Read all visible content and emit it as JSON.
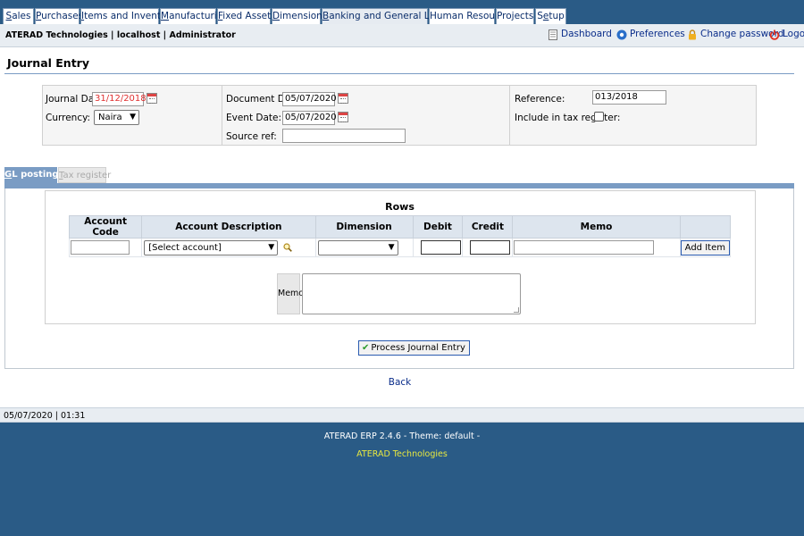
{
  "top_menu": [
    {
      "text": "Sales",
      "u": "S",
      "rest": "ales"
    },
    {
      "text": "Purchases",
      "u": "P",
      "rest": "urchases"
    },
    {
      "text": "Items and Inventory",
      "u": "I",
      "rest": "tems and Inventory"
    },
    {
      "text": "Manufacturing",
      "u": "M",
      "rest": "anufacturing"
    },
    {
      "text": "Fixed Assets",
      "u": "F",
      "rest": "ixed Assets"
    },
    {
      "text": "Dimensions",
      "u": "D",
      "rest": "imensions"
    },
    {
      "text": "Banking and General Ledger",
      "u": "B",
      "rest": "anking and General Ledger"
    },
    {
      "text": "Human Resource",
      "u": "",
      "rest": "Human Resource"
    },
    {
      "text": "Projects",
      "u": "",
      "rest": "Projects"
    },
    {
      "text": "Setup",
      "pre": "S",
      "u": "e",
      "rest": "tup"
    }
  ],
  "header": {
    "company": "ATERAD Technologies | localhost | Administrator",
    "dashboard": "Dashboard",
    "preferences": "Preferences",
    "change_password": "Change password",
    "logout": "Logout"
  },
  "page_title": "Journal Entry",
  "form": {
    "journal_date_label": "Journal Date:",
    "journal_date_value": "31/12/2018",
    "currency_label": "Currency:",
    "currency_value": "Naira",
    "document_date_label": "Document Date:",
    "document_date_value": "05/07/2020",
    "event_date_label": "Event Date:",
    "event_date_value": "05/07/2020",
    "source_ref_label": "Source ref:",
    "source_ref_value": "",
    "reference_label": "Reference:",
    "reference_value": "013/2018",
    "tax_register_label": "Include in tax register:"
  },
  "tabs": {
    "gl_postings": {
      "u": "G",
      "rest": "L postings"
    },
    "tax_register": {
      "u": "T",
      "rest": "ax register"
    }
  },
  "rows": {
    "title": "Rows",
    "columns": [
      "Account Code",
      "Account Description",
      "Dimension",
      "Debit",
      "Credit",
      "Memo"
    ],
    "account_select": "[Select account]",
    "add_item": "Add Item"
  },
  "memo_label": "Memo",
  "process_button": "Process Journal Entry",
  "back": "Back",
  "status": "05/07/2020 | 01:31",
  "footer": {
    "version": "ATERAD ERP 2.4.6 - Theme: default -",
    "company": "ATERAD Technologies"
  },
  "colors": {
    "background": "#2a5b86",
    "accent": "#7a9cc4",
    "date_text": "#e03030",
    "footer_company": "#e8e840"
  }
}
